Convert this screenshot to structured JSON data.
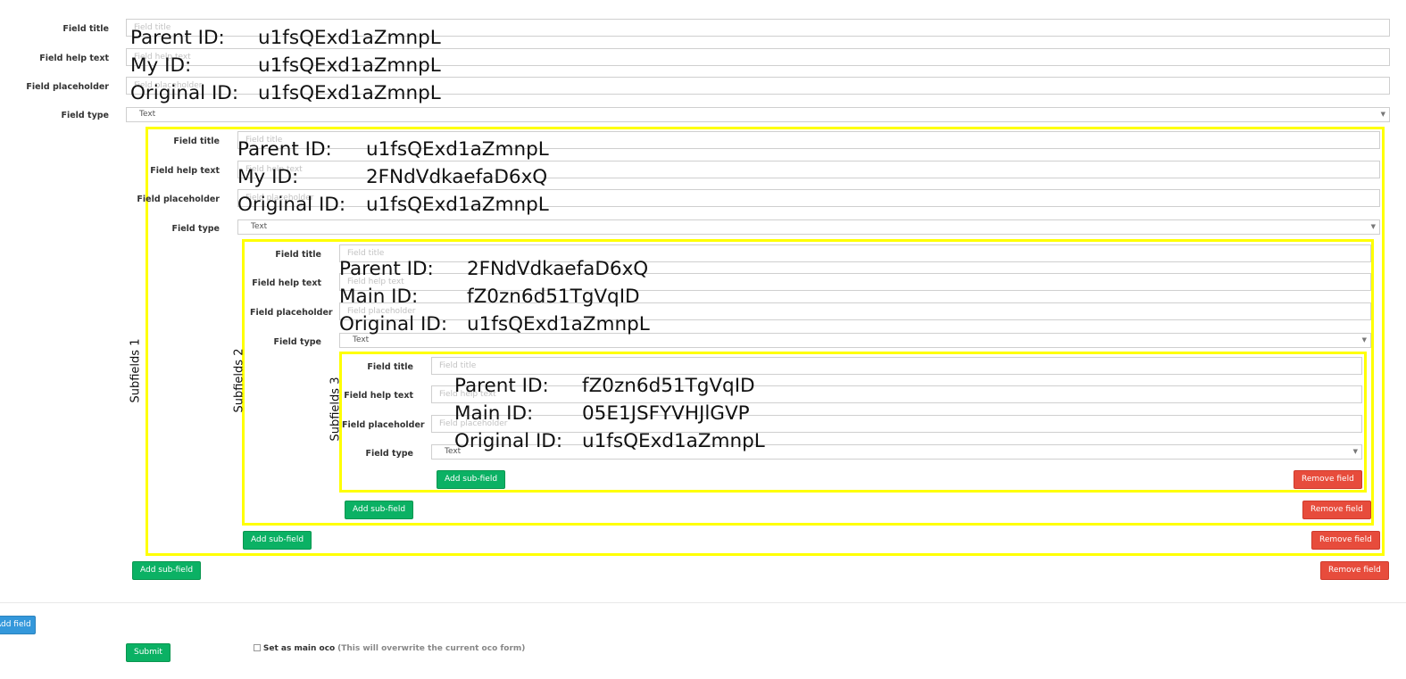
{
  "labels": {
    "field_title": "Field title",
    "field_help_text": "Field help text",
    "field_placeholder": "Field placeholder",
    "field_type": "Field type"
  },
  "placeholders": {
    "field_title": "Field title",
    "field_help_text": "Field help text",
    "field_placeholder": "Field placeholder"
  },
  "field_type_value": "Text",
  "levels": [
    {
      "subfields_label": "",
      "ids": [
        {
          "key": "Parent ID:",
          "value": "u1fsQExd1aZmnpL"
        },
        {
          "key": "My ID:",
          "value": "u1fsQExd1aZmnpL"
        },
        {
          "key": "Original ID:",
          "value": "u1fsQExd1aZmnpL"
        }
      ]
    },
    {
      "subfields_label": "Subfields 1",
      "ids": [
        {
          "key": "Parent ID:",
          "value": "u1fsQExd1aZmnpL"
        },
        {
          "key": "My ID:",
          "value": "2FNdVdkaefaD6xQ"
        },
        {
          "key": "Original ID:",
          "value": "u1fsQExd1aZmnpL"
        }
      ]
    },
    {
      "subfields_label": "Subfields 2",
      "ids": [
        {
          "key": "Parent ID:",
          "value": "2FNdVdkaefaD6xQ"
        },
        {
          "key": "Main ID:",
          "value": "fZ0zn6d51TgVqID"
        },
        {
          "key": "Original ID:",
          "value": "u1fsQExd1aZmnpL"
        }
      ]
    },
    {
      "subfields_label": "Subfields 3",
      "ids": [
        {
          "key": "Parent ID:",
          "value": "fZ0zn6d51TgVqID"
        },
        {
          "key": "Main ID:",
          "value": "05E1JSFYVHJlGVP"
        },
        {
          "key": "Original ID:",
          "value": "u1fsQExd1aZmnpL"
        }
      ]
    }
  ],
  "buttons": {
    "add_sub_field": "Add sub-field",
    "remove_field": "Remove field",
    "add_field": "Add field",
    "submit": "Submit"
  },
  "main_oco": {
    "label": "Set as main oco",
    "note": "(This will overwrite the current oco form)"
  },
  "colors": {
    "highlight": "#ffff00",
    "add_button": "#0bb164",
    "remove_button": "#e74c3c",
    "add_field_button": "#3498db"
  }
}
